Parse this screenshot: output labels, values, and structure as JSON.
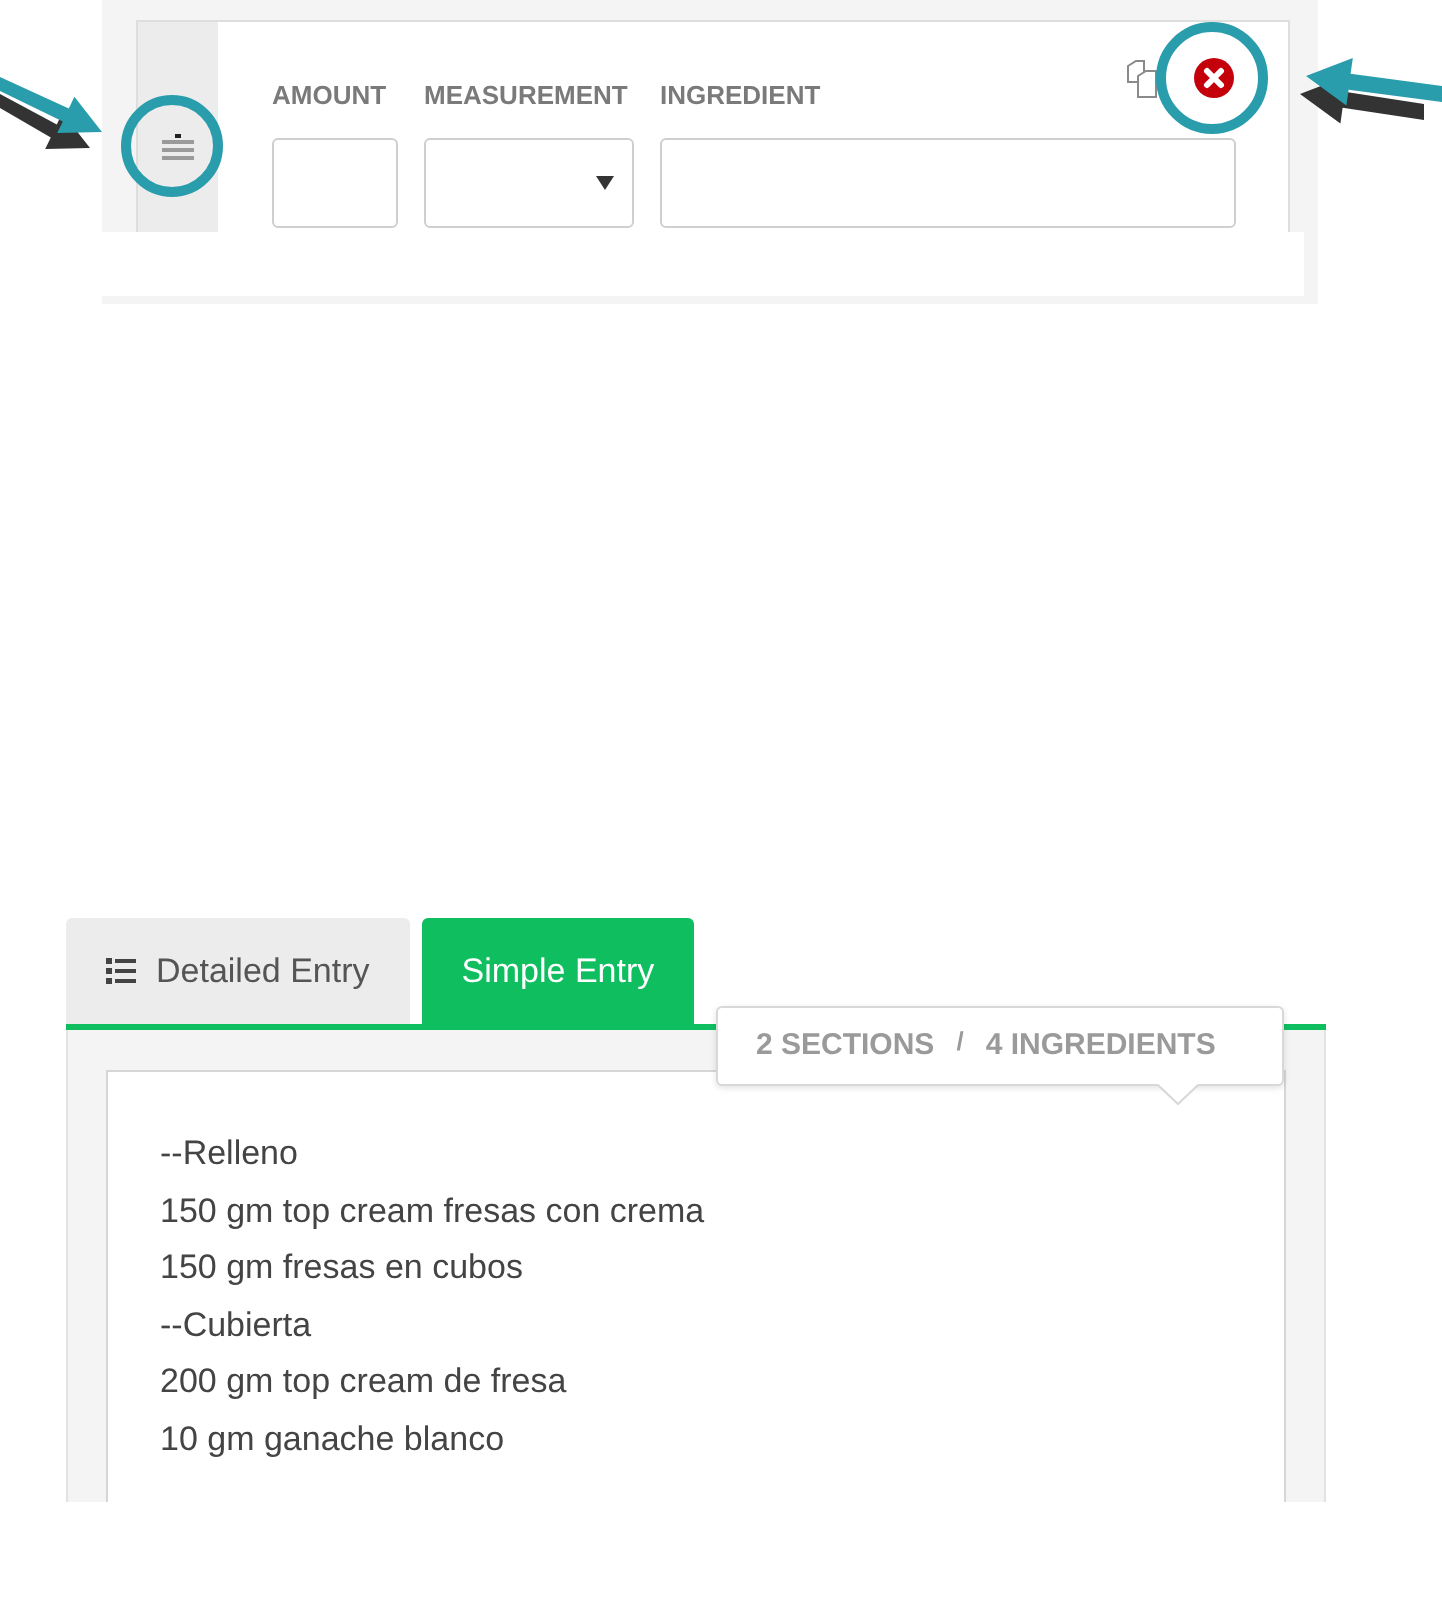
{
  "row_editor": {
    "columns": [
      {
        "label": "AMOUNT",
        "kind": "input"
      },
      {
        "label": "MEASUREMENT",
        "kind": "select"
      },
      {
        "label": "INGREDIENT",
        "kind": "input"
      }
    ]
  },
  "tabs": [
    {
      "label": "Detailed Entry",
      "selected": false
    },
    {
      "label": "Simple Entry",
      "selected": true
    }
  ],
  "counts": {
    "sections": "2 SECTIONS",
    "separator": "/",
    "ingredients": "4 INGREDIENTS"
  },
  "text_area": {
    "lines": [
      "--Relleno",
      "150 gm top cream fresas con crema",
      "150 gm fresas en cubos",
      "--Cubierta",
      "200 gm top cream de fresa",
      "10 gm ganache blanco"
    ]
  }
}
